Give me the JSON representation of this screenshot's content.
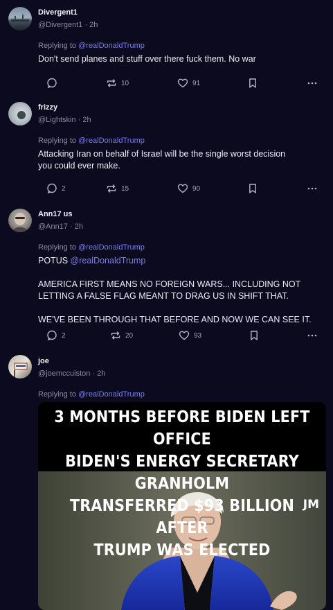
{
  "posts": [
    {
      "display_name": "Divergent1",
      "handle": "@Divergent1",
      "time": "2h",
      "replying_label": "Replying to",
      "replying_to": "@realDonaldTrump",
      "text": "Don't send planes and stuff over there fuck them. No war",
      "replies": "",
      "reposts": "10",
      "likes": "91"
    },
    {
      "display_name": "frizzy",
      "handle": "@Lightskin",
      "time": "2h",
      "replying_label": "Replying to",
      "replying_to": "@realDonaldTrump",
      "text_line1": "Attacking Iran on behalf of Israel will be the single worst decision",
      "text_line2": "you could ever make.",
      "replies": "2",
      "reposts": "15",
      "likes": "90"
    },
    {
      "display_name": "Ann17 us",
      "handle": "@Ann17",
      "time": "2h",
      "replying_label": "Replying to",
      "replying_to": "@realDonaldTrump",
      "text_prefix": "POTUS",
      "text_mention": "@realDonaldTrump",
      "para1_line1": "AMERICA FIRST MEANS NO FOREIGN WARS... INCLUDING NOT",
      "para1_line2": "LETTING A FALSE FLAG MEANT TO DRAG US IN SHIFT THAT.",
      "para2": "WE'VE BEEN THROUGH THAT BEFORE AND NOW WE CAN SEE IT.",
      "replies": "2",
      "reposts": "20",
      "likes": "93"
    },
    {
      "display_name": "joe",
      "handle": "@joemccuiston",
      "time": "2h",
      "replying_label": "Replying to",
      "replying_to": "@realDonaldTrump",
      "image_caption_lines": [
        "3 MONTHS BEFORE BIDEN LEFT OFFICE",
        "BIDEN'S ENERGY SECRETARY GRANHOLM",
        "TRANSFERRED $93 BILLION AFTER",
        "TRUMP WAS ELECTED"
      ],
      "image_watermark": "JM"
    }
  ],
  "separator": "·",
  "icons": {
    "reply": "speech-bubble-icon",
    "repost": "repost-arrows-icon",
    "like": "heart-icon",
    "bookmark": "bookmark-icon",
    "more": "more-dots-icon"
  },
  "colors": {
    "background": "#0b0a1e",
    "mention": "#7b7cf2",
    "muted": "#8d8aa3"
  }
}
